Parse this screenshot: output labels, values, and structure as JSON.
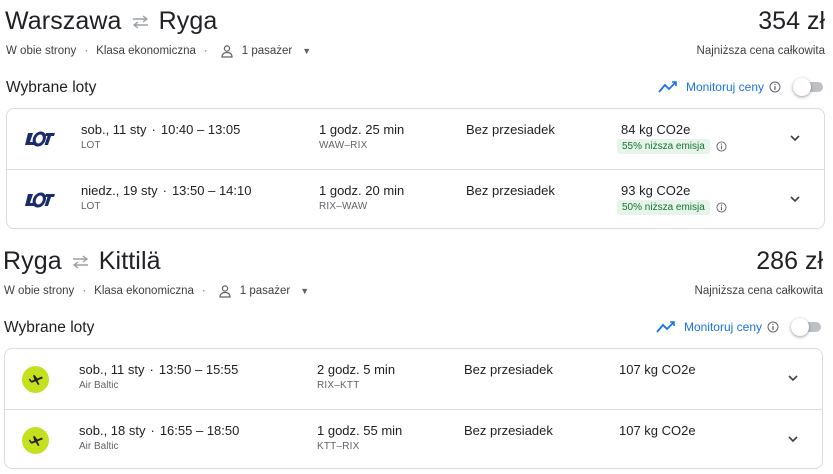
{
  "sections": [
    {
      "origin": "Warszawa",
      "destination": "Ryga",
      "price": "354 zł",
      "trip_type": "W obie strony",
      "cabin": "Klasa ekonomiczna",
      "passengers": "1 pasażer",
      "price_caption": "Najniższa cena całkowita",
      "selected_heading": "Wybrane loty",
      "monitor_label": "Monitoruj ceny",
      "flights": [
        {
          "airline_logo": "lot-logo",
          "date": "sob., 11 sty",
          "time_range": "10:40 – 13:05",
          "carrier": "LOT",
          "duration": "1 godz. 25 min",
          "airports": "WAW–RIX",
          "stops": "Bez przesiadek",
          "emissions": "84 kg CO2e",
          "emission_badge": "55% niższa emisja"
        },
        {
          "airline_logo": "lot-logo",
          "date": "niedz., 19 sty",
          "time_range": "13:50 – 14:10",
          "carrier": "LOT",
          "duration": "1 godz. 20 min",
          "airports": "RIX–WAW",
          "stops": "Bez przesiadek",
          "emissions": "93 kg CO2e",
          "emission_badge": "50% niższa emisja"
        }
      ]
    },
    {
      "origin": "Ryga",
      "destination": "Kittilä",
      "price": "286 zł",
      "trip_type": "W obie strony",
      "cabin": "Klasa ekonomiczna",
      "passengers": "1 pasażer",
      "price_caption": "Najniższa cena całkowita",
      "selected_heading": "Wybrane loty",
      "monitor_label": "Monitoruj ceny",
      "flights": [
        {
          "airline_logo": "airbaltic-logo",
          "date": "sob., 11 sty",
          "time_range": "13:50 – 15:55",
          "carrier": "Air Baltic",
          "duration": "2 godz. 5 min",
          "airports": "RIX–KTT",
          "stops": "Bez przesiadek",
          "emissions": "107 kg CO2e"
        },
        {
          "airline_logo": "airbaltic-logo",
          "date": "sob., 18 sty",
          "time_range": "16:55 – 18:50",
          "carrier": "Air Baltic",
          "duration": "1 godz. 55 min",
          "airports": "KTT–RIX",
          "stops": "Bez przesiadek",
          "emissions": "107 kg CO2e"
        }
      ]
    }
  ],
  "colors": {
    "accent": "#1a73e8",
    "badge_bg": "#e6f4ea",
    "badge_text": "#137333",
    "lot_logo": "#1a2c6b",
    "airbaltic_logo": "#c5e01e",
    "border": "#dadce0"
  },
  "icons": {
    "swap": "arrows-swap-icon",
    "person": "person-icon",
    "caret": "caret-down-icon",
    "trend": "trending-line-icon",
    "info": "info-circle-icon",
    "expand": "chevron-down-icon"
  }
}
